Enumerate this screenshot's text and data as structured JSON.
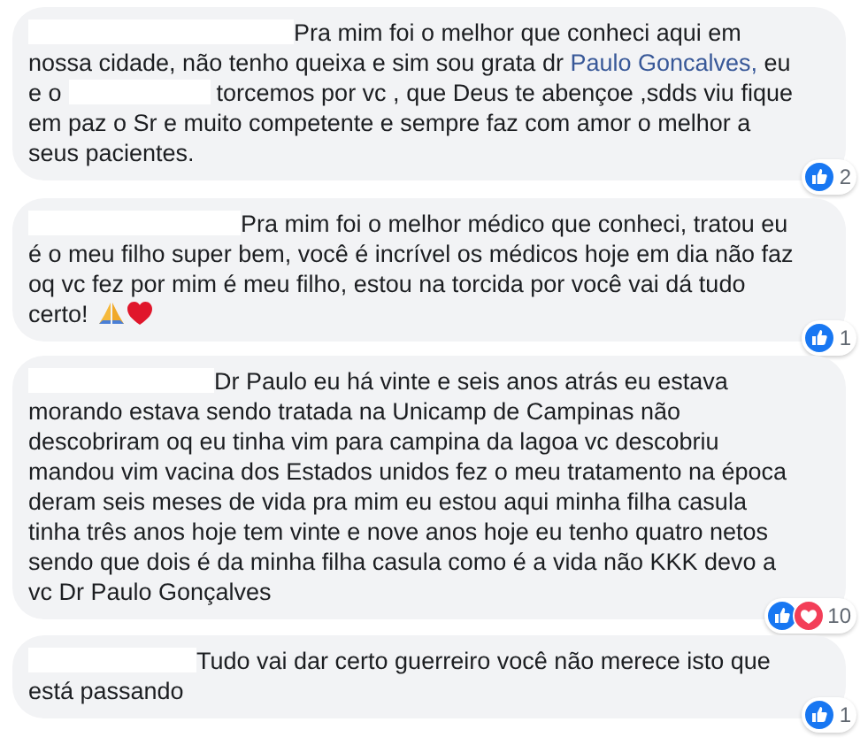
{
  "comments": [
    {
      "body": [
        {
          "kind": "redacted"
        },
        {
          "kind": "text",
          "text": "Pra mim foi o melhor que conheci aqui em nossa cidade, não tenho queixa e sim sou grata dr "
        },
        {
          "kind": "link",
          "text": "Paulo Goncalves,"
        },
        {
          "kind": "text",
          "text": " eu e o "
        },
        {
          "kind": "redacted"
        },
        {
          "kind": "text",
          "text": " torcemos por vc , que Deus te abençoe ,sdds viu fique em paz o Sr e muito competente e sempre faz com amor o melhor a seus pacientes."
        }
      ],
      "reactions": [
        {
          "kind": "like"
        }
      ],
      "count": "2"
    },
    {
      "body": [
        {
          "kind": "redacted"
        },
        {
          "kind": "text",
          "text": "Pra mim foi o melhor médico que conheci, tratou eu é o meu filho super bem, você é incrível os médicos hoje em dia não faz oq vc fez por mim é meu filho, estou na torcida por você vai dá tudo certo! "
        },
        {
          "kind": "hands"
        },
        {
          "kind": "heart"
        }
      ],
      "reactions": [
        {
          "kind": "like"
        }
      ],
      "count": "1"
    },
    {
      "body": [
        {
          "kind": "redacted"
        },
        {
          "kind": "text",
          "text": "Dr Paulo eu há vinte e seis anos atrás eu estava morando estava sendo tratada na Unicamp de Campinas não descobriram oq eu tinha vim para campina da lagoa vc descobriu mandou vim vacina dos Estados unidos fez o meu tratamento na época deram seis meses de vida pra mim eu estou aqui minha filha casula tinha três anos hoje tem vinte e nove anos hoje eu tenho quatro netos sendo que dois é da minha filha casula como é a vida não KKK devo a vc Dr Paulo Gonçalves"
        }
      ],
      "reactions": [
        {
          "kind": "like"
        },
        {
          "kind": "love"
        }
      ],
      "count": "10"
    },
    {
      "body": [
        {
          "kind": "redacted"
        },
        {
          "kind": "text",
          "text": "Tudo vai dar certo guerreiro você não merece isto que está passando"
        }
      ],
      "reactions": [
        {
          "kind": "like"
        }
      ],
      "count": "1"
    }
  ]
}
